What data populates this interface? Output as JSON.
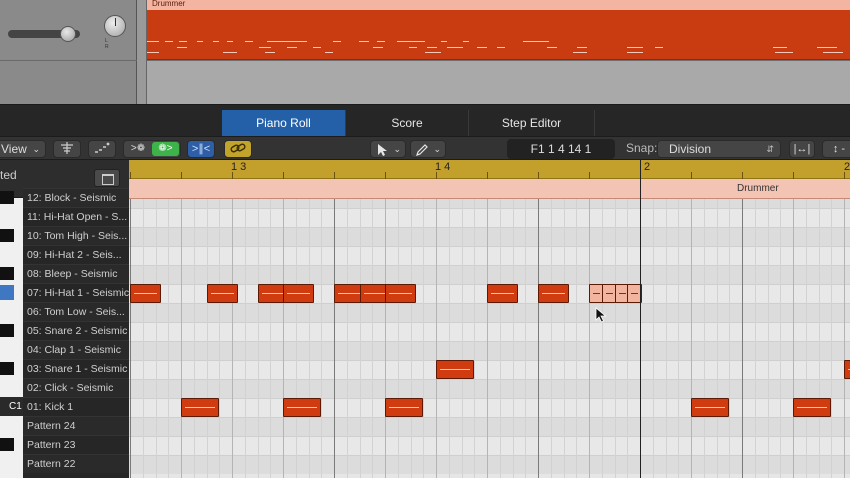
{
  "colors": {
    "accent_tab": "#2460a8",
    "note_fill": "#d03c10",
    "ruler_gold": "#c3a02b",
    "region_header": "#f3b5a2",
    "link_button": "#c2a42a"
  },
  "region": {
    "name": "Drummer"
  },
  "pan": {
    "labels": "L R"
  },
  "tabs": [
    {
      "label": "Piano Roll",
      "active": true
    },
    {
      "label": "Score",
      "active": false
    },
    {
      "label": "Step Editor",
      "active": false
    }
  ],
  "toolbar": {
    "view_label": "View",
    "midi_in_icon": "midi-in-icon",
    "link_icon": "chain-link-icon",
    "pointer_tool_icon": "pointer-arrow-icon",
    "pencil_tool_icon": "pencil-icon",
    "position": "F1  1 4 14 1",
    "snap_label": "Snap:",
    "snap_value": "Division"
  },
  "keylist": {
    "header": "ted",
    "c1_label": "C1",
    "rows": [
      "12: Block - Seismic",
      "11: Hi-Hat Open  - S...",
      "10: Tom High - Seis...",
      "09: Hi-Hat 2 - Seis...",
      "08: Bleep - Seismic",
      "07: Hi-Hat 1 - Seismic",
      "06: Tom Low - Seis...",
      "05: Snare 2 - Seismic",
      "04: Clap 1 - Seismic",
      "03: Snare 1 - Seismic",
      "02: Click - Seismic",
      "01: Kick 1",
      "Pattern 24",
      "Pattern 23",
      "Pattern 22"
    ]
  },
  "ruler": {
    "bars": [
      "1 3",
      "1 4",
      "2",
      "2"
    ],
    "region_label": "Drummer"
  },
  "notes": [
    {
      "row": 5,
      "x0": 0.0,
      "x1": 0.6,
      "selected": false
    },
    {
      "row": 5,
      "x0": 1.5,
      "x1": 2.1,
      "selected": false
    },
    {
      "row": 5,
      "x0": 2.5,
      "x1": 3.1,
      "selected": false
    },
    {
      "row": 5,
      "x0": 3.0,
      "x1": 3.6,
      "selected": false
    },
    {
      "row": 5,
      "x0": 4.0,
      "x1": 4.6,
      "selected": false
    },
    {
      "row": 5,
      "x0": 4.5,
      "x1": 5.1,
      "selected": false
    },
    {
      "row": 5,
      "x0": 5.0,
      "x1": 5.6,
      "selected": false
    },
    {
      "row": 5,
      "x0": 7.0,
      "x1": 7.6,
      "selected": false
    },
    {
      "row": 5,
      "x0": 8.0,
      "x1": 8.6,
      "selected": false
    },
    {
      "row": 5,
      "x0": 9.0,
      "x1": 9.3,
      "selected": true
    },
    {
      "row": 5,
      "x0": 9.25,
      "x1": 9.55,
      "selected": true
    },
    {
      "row": 5,
      "x0": 9.5,
      "x1": 9.8,
      "selected": true
    },
    {
      "row": 5,
      "x0": 9.75,
      "x1": 10.05,
      "selected": true
    },
    {
      "row": 9,
      "x0": 6.0,
      "x1": 6.75,
      "selected": false
    },
    {
      "row": 9,
      "x0": 14.0,
      "x1": 14.5,
      "selected": false
    },
    {
      "row": 11,
      "x0": 1.0,
      "x1": 1.75,
      "selected": false
    },
    {
      "row": 11,
      "x0": 3.0,
      "x1": 3.75,
      "selected": false
    },
    {
      "row": 11,
      "x0": 5.0,
      "x1": 5.75,
      "selected": false
    },
    {
      "row": 11,
      "x0": 11.0,
      "x1": 11.75,
      "selected": false
    },
    {
      "row": 11,
      "x0": 13.0,
      "x1": 13.75,
      "selected": false
    }
  ]
}
